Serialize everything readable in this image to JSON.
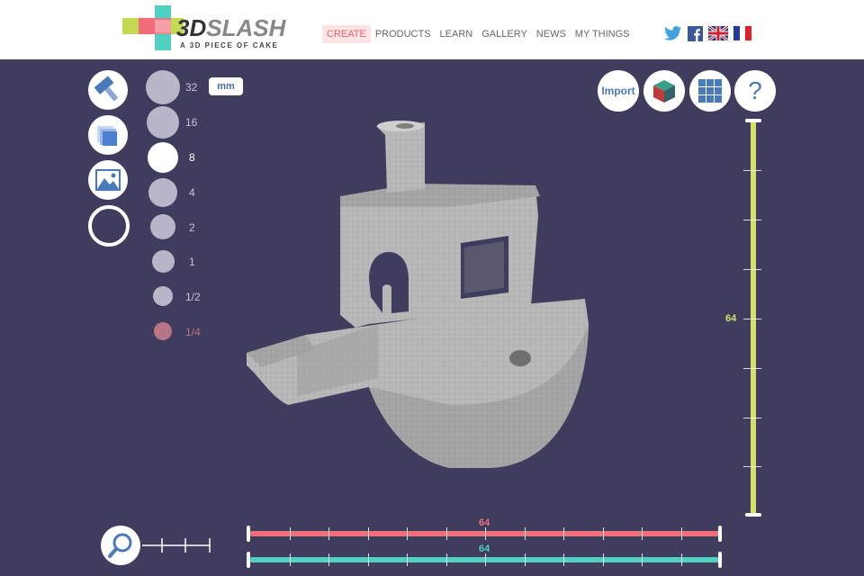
{
  "header": {
    "logo": {
      "brand_prefix": "3D",
      "brand_suffix": "SLASH",
      "tagline": "A 3D PIECE OF CAKE"
    },
    "nav": [
      {
        "label": "CREATE",
        "active": true
      },
      {
        "label": "PRODUCTS"
      },
      {
        "label": "LEARN"
      },
      {
        "label": "GALLERY"
      },
      {
        "label": "NEWS"
      },
      {
        "label": "MY THINGS"
      }
    ],
    "social": [
      "twitter-icon",
      "facebook-icon",
      "uk-flag-icon",
      "france-flag-icon"
    ]
  },
  "tools": [
    "hammer-tool-icon",
    "cube-layers-tool-icon",
    "image-tool-icon",
    "circle-tool-icon"
  ],
  "sizes": {
    "unit": "mm",
    "options": [
      "32",
      "16",
      "8",
      "4",
      "2",
      "1",
      "1/2",
      "1/4"
    ],
    "selected": "8"
  },
  "toolbar_right": {
    "import_label": "Import",
    "icons": [
      "color-cube-icon",
      "grid-icon",
      "help-icon"
    ],
    "help_glyph": "?"
  },
  "sliders": {
    "vertical_value": "64",
    "red_value": "64",
    "teal_value": "64"
  },
  "colors": {
    "background": "#3f3c5e",
    "accent_red": "#f0707a",
    "accent_teal": "#4fd0c0",
    "accent_yellow": "#d6e06a",
    "model_gray": "#b5b5b5"
  }
}
